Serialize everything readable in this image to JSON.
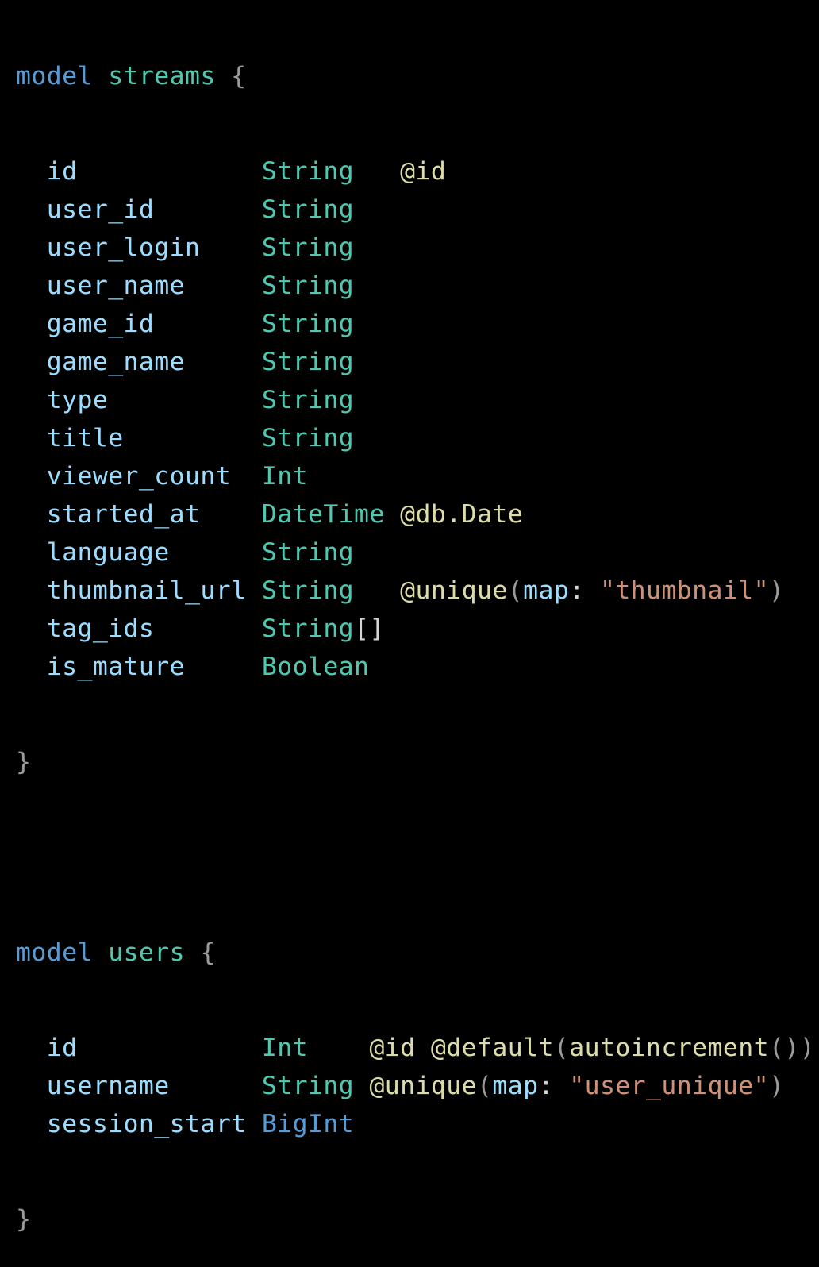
{
  "code": {
    "keyword_model": "model",
    "open_brace": "{",
    "close_brace": "}",
    "streams": {
      "name": "streams",
      "fields": [
        {
          "name": "id",
          "pad": "            ",
          "type": "String",
          "tpad": "   ",
          "attr": "@id"
        },
        {
          "name": "user_id",
          "pad": "       ",
          "type": "String"
        },
        {
          "name": "user_login",
          "pad": "    ",
          "type": "String"
        },
        {
          "name": "user_name",
          "pad": "     ",
          "type": "String"
        },
        {
          "name": "game_id",
          "pad": "       ",
          "type": "String"
        },
        {
          "name": "game_name",
          "pad": "     ",
          "type": "String"
        },
        {
          "name": "type",
          "pad": "          ",
          "type": "String"
        },
        {
          "name": "title",
          "pad": "         ",
          "type": "String"
        },
        {
          "name": "viewer_count",
          "pad": "  ",
          "type": "Int"
        },
        {
          "name": "started_at",
          "pad": "    ",
          "type": "DateTime",
          "tpad": " ",
          "attr": "@db.Date"
        },
        {
          "name": "language",
          "pad": "      ",
          "type": "String"
        },
        {
          "name": "thumbnail_url",
          "pad": " ",
          "type": "String",
          "tpad": "   ",
          "attr": "@unique",
          "paren_open": "(",
          "arg_key": "map",
          "colon": ": ",
          "arg_val": "\"thumbnail\"",
          "paren_close": ")"
        },
        {
          "name": "tag_ids",
          "pad": "       ",
          "type": "String",
          "suffix": "[]"
        },
        {
          "name": "is_mature",
          "pad": "     ",
          "type": "Boolean"
        }
      ]
    },
    "users": {
      "name": "users",
      "fields": [
        {
          "name": "id",
          "pad": "            ",
          "type": "Int",
          "tpad": "    ",
          "attr": "@id",
          "attr2": " @default",
          "paren_open": "(",
          "func": "autoincrement",
          "call": "()",
          "paren_close": ")"
        },
        {
          "name": "username",
          "pad": "      ",
          "type": "String",
          "tpad": " ",
          "attr": "@unique",
          "paren_open": "(",
          "arg_key": "map",
          "colon": ": ",
          "arg_val": "\"user_unique\"",
          "paren_close": ")"
        },
        {
          "name": "session_start",
          "pad": " ",
          "type": "BigInt",
          "type_builtin": true
        }
      ]
    }
  },
  "colors": {
    "background": "#000000",
    "keyword": "#569cd6",
    "model_name": "#4ec9b0",
    "field": "#9cdcfe",
    "type": "#4ec9b0",
    "attribute": "#dcdcaa",
    "string": "#ce9178",
    "punctuation": "#9a9a9a"
  }
}
